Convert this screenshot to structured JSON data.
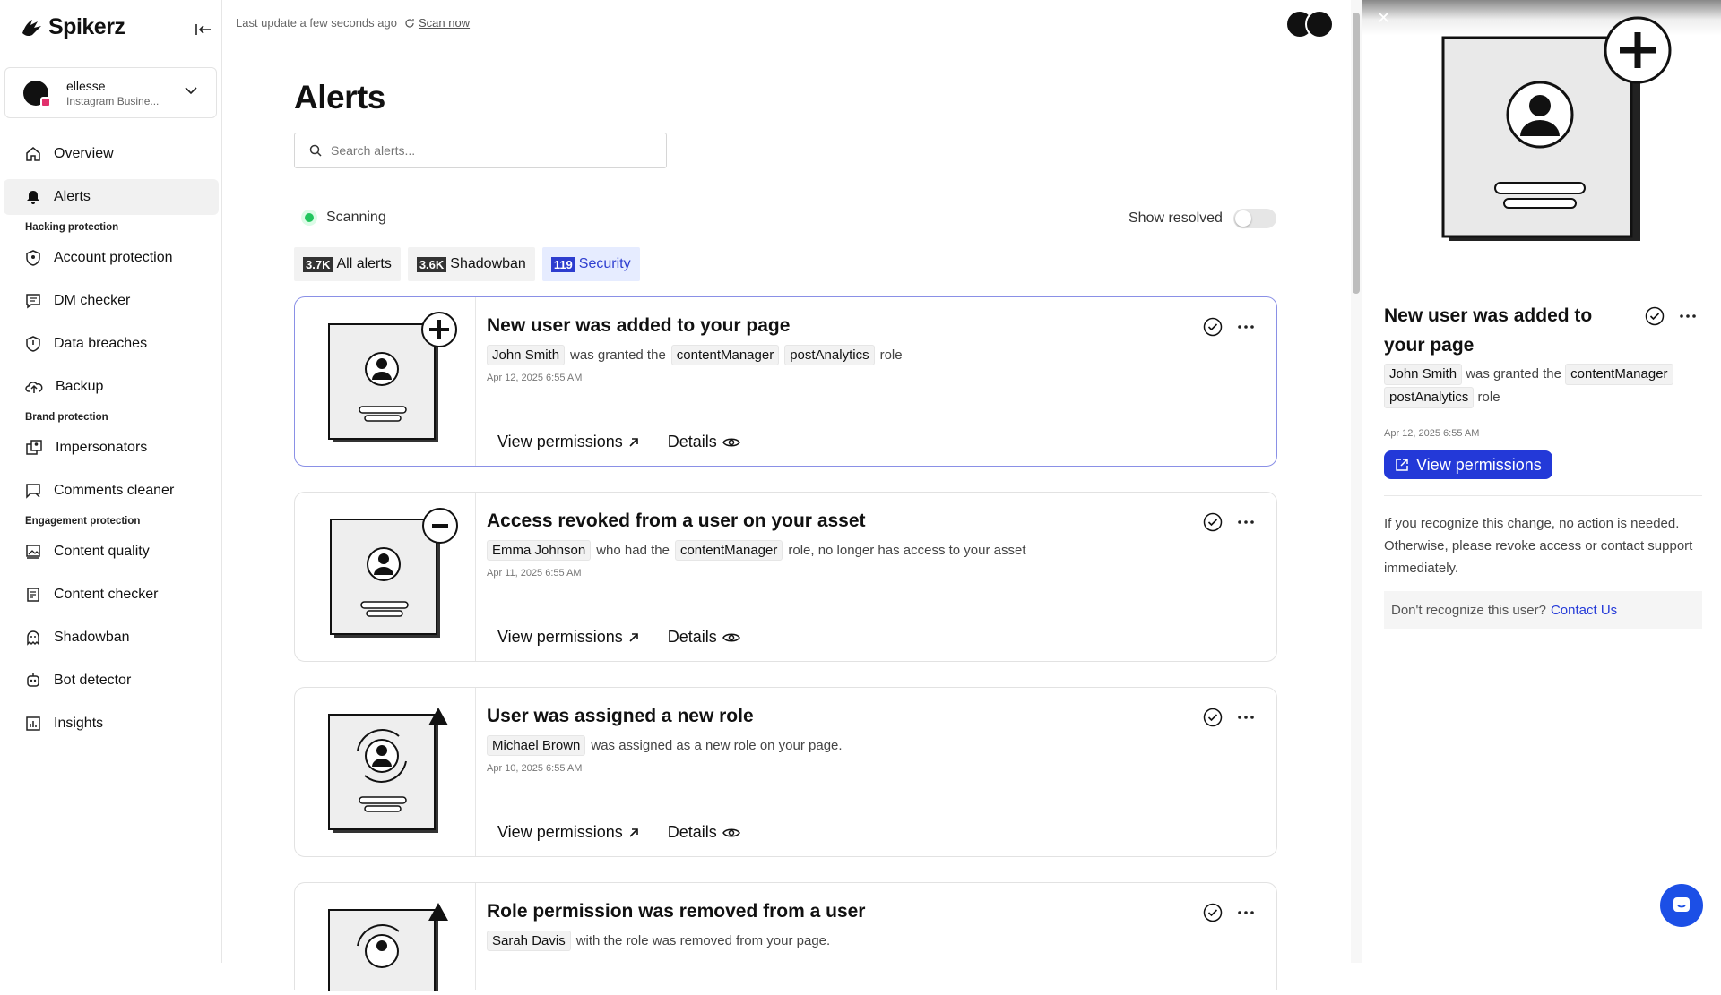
{
  "app": {
    "name": "Spikerz"
  },
  "account": {
    "name": "ellesse",
    "type": "Instagram Busine..."
  },
  "topbar": {
    "last_update": "Last update a few seconds ago",
    "scan_now": "Scan now"
  },
  "nav": {
    "overview": "Overview",
    "alerts": "Alerts",
    "section_hacking": "Hacking protection",
    "account_protection": "Account protection",
    "dm_checker": "DM checker",
    "data_breaches": "Data breaches",
    "backup": "Backup",
    "section_brand": "Brand protection",
    "impersonators": "Impersonators",
    "comments_cleaner": "Comments cleaner",
    "section_engagement": "Engagement protection",
    "content_quality": "Content quality",
    "content_checker": "Content checker",
    "shadowban": "Shadowban",
    "bot_detector": "Bot detector",
    "insights": "Insights"
  },
  "main": {
    "title": "Alerts",
    "search_placeholder": "Search alerts...",
    "scanning": "Scanning",
    "show_resolved": "Show resolved",
    "tabs": [
      {
        "count": "3.7K",
        "label": "All alerts"
      },
      {
        "count": "3.6K",
        "label": "Shadowban"
      },
      {
        "count": "119",
        "label": "Security"
      }
    ]
  },
  "cards": [
    {
      "title": "New user was added to your page",
      "user": "John Smith",
      "text1": "was granted the",
      "role1": "contentManager",
      "role2": "postAnalytics",
      "text2": "role",
      "date": "Apr 12, 2025 6:55 AM",
      "view": "View permissions",
      "details": "Details"
    },
    {
      "title": "Access revoked from a user on your asset",
      "user": "Emma Johnson",
      "text1": "who had the",
      "role1": "contentManager",
      "text2": "role, no longer has access to your asset",
      "date": "Apr 11, 2025 6:55 AM",
      "view": "View permissions",
      "details": "Details"
    },
    {
      "title": "User was assigned a new role",
      "user": "Michael Brown",
      "text1": "was assigned as a new role on your page.",
      "date": "Apr 10, 2025 6:55 AM",
      "view": "View permissions",
      "details": "Details"
    },
    {
      "title": "Role permission was removed from a user",
      "user": "Sarah Davis",
      "text1": "with the role was removed from your page."
    }
  ],
  "panel": {
    "title": "New user was added to your page",
    "user": "John Smith",
    "text1": "was granted the",
    "role1": "contentManager",
    "role2": "postAnalytics",
    "text2": "role",
    "date": "Apr 12, 2025 6:55 AM",
    "view": "View permissions",
    "help": "If you recognize this change, no action is needed. Otherwise, please revoke access or contact support immediately.",
    "contact_prompt": "Don't recognize this user?",
    "contact_link": "Contact Us"
  },
  "colors": {
    "accent": "#2339d8",
    "scanning": "#22c55e",
    "selected_border": "#8a90e6"
  }
}
